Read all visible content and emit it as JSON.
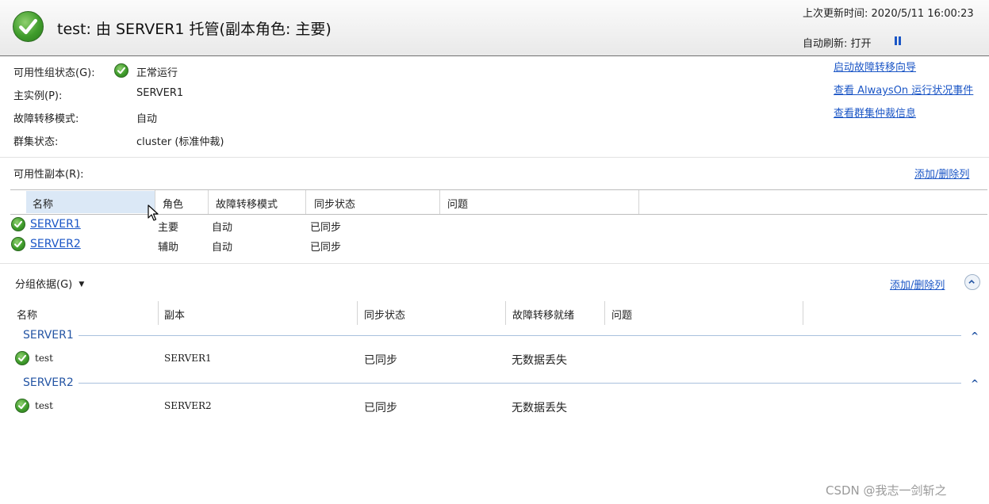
{
  "header": {
    "title": "test: 由 SERVER1 托管(副本角色: 主要)",
    "last_update": "上次更新时间: 2020/5/11 16:00:23",
    "auto_refresh": "自动刷新: 打开"
  },
  "info": {
    "group_state_label": "可用性组状态(G):",
    "group_state_value": "正常运行",
    "primary_label": "主实例(P):",
    "primary_value": "SERVER1",
    "failover_label": "故障转移模式:",
    "failover_value": "自动",
    "cluster_label": "群集状态:",
    "cluster_value": "cluster (标准仲裁)"
  },
  "links": {
    "failover_wizard": "启动故障转移向导",
    "alwayson_events": "查看 AlwaysOn 运行状况事件",
    "quorum_info": "查看群集仲裁信息"
  },
  "replicas": {
    "title": "可用性副本(R):",
    "add_remove": "添加/删除列",
    "columns": [
      "名称",
      "角色",
      "故障转移模式",
      "同步状态",
      "问题"
    ],
    "rows": [
      {
        "name": "SERVER1",
        "role": "主要",
        "failover": "自动",
        "sync": "已同步"
      },
      {
        "name": "SERVER2",
        "role": "辅助",
        "failover": "自动",
        "sync": "已同步"
      }
    ]
  },
  "databases": {
    "group_by": "分组依据(G)",
    "add_remove": "添加/删除列",
    "columns": [
      "名称",
      "副本",
      "同步状态",
      "故障转移就绪",
      "问题"
    ],
    "groups": [
      {
        "server": "SERVER1",
        "row": {
          "name": "test",
          "replica": "SERVER1",
          "sync": "已同步",
          "ready": "无数据丢失"
        }
      },
      {
        "server": "SERVER2",
        "row": {
          "name": "test",
          "replica": "SERVER2",
          "sync": "已同步",
          "ready": "无数据丢失"
        }
      }
    ]
  },
  "watermark": "CSDN @我志一剑斩之",
  "colors": {
    "link": "#1b56c6",
    "ok_green": "#3f9c2b",
    "group_header": "#2455a4"
  }
}
